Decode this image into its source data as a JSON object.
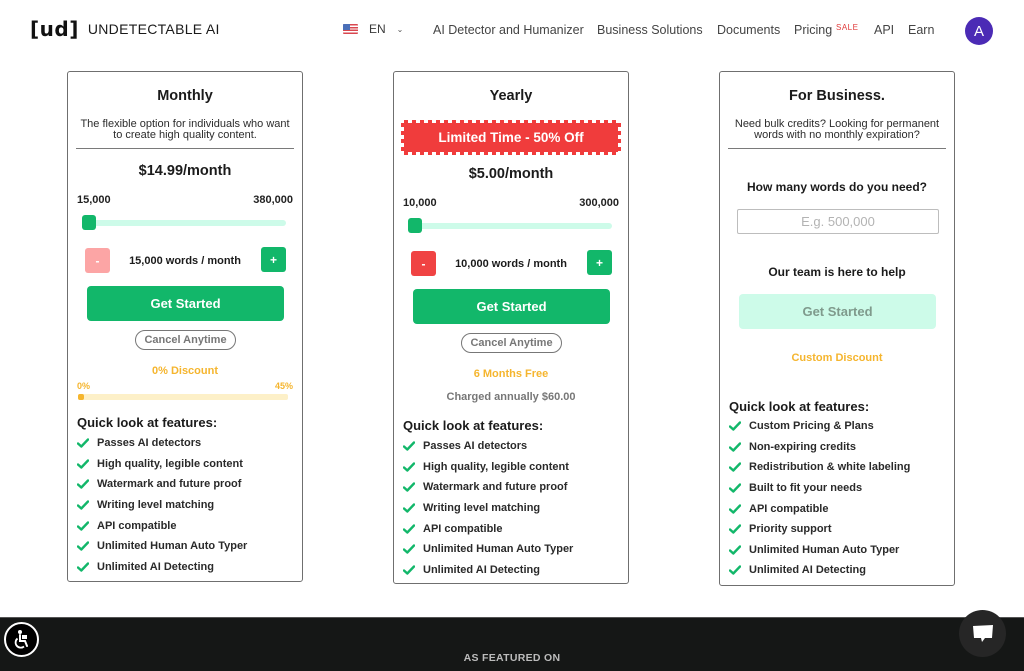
{
  "header": {
    "logo_mark": "[ud]",
    "logo_text": "UNDETECTABLE AI",
    "language": "EN",
    "nav": [
      {
        "label": "AI Detector and Humanizer"
      },
      {
        "label": "Business Solutions"
      },
      {
        "label": "Documents"
      },
      {
        "label": "Pricing"
      },
      {
        "label": "API"
      },
      {
        "label": "Earn"
      }
    ],
    "sale_badge": "SALE",
    "avatar_initial": "A"
  },
  "colors": {
    "accent_green": "#12b76a",
    "light_green": "#cdfbe9",
    "sale_red": "#f03c3c",
    "discount_orange": "#f5b52e",
    "avatar_purple": "#4b2bb5"
  },
  "plans": {
    "monthly": {
      "title": "Monthly",
      "description": "The flexible option for individuals who want to create high quality content.",
      "price": "$14.99/month",
      "range_min": "15,000",
      "range_max": "380,000",
      "slider_value_fraction": 0,
      "minus_label": "-",
      "plus_label": "+",
      "words": "15,000 words / month",
      "cta": "Get Started",
      "cancel": "Cancel Anytime",
      "discount_text": "0% Discount",
      "discount_min": "0%",
      "discount_max": "45%",
      "discount_percent": 0,
      "features_title": "Quick look at features:",
      "features": [
        "Passes AI detectors",
        "High quality, legible content",
        "Watermark and future proof",
        "Writing level matching",
        "API compatible",
        "Unlimited Human Auto Typer",
        "Unlimited AI Detecting"
      ]
    },
    "yearly": {
      "title": "Yearly",
      "banner": "Limited Time - 50% Off",
      "price": "$5.00/month",
      "range_min": "10,000",
      "range_max": "300,000",
      "slider_value_fraction": 0,
      "minus_label": "-",
      "plus_label": "+",
      "words": "10,000 words / month",
      "cta": "Get Started",
      "cancel": "Cancel Anytime",
      "bonus": "6 Months Free",
      "charged": "Charged annually $60.00",
      "features_title": "Quick look at features:",
      "features": [
        "Passes AI detectors",
        "High quality, legible content",
        "Watermark and future proof",
        "Writing level matching",
        "API compatible",
        "Unlimited Human Auto Typer",
        "Unlimited AI Detecting"
      ]
    },
    "business": {
      "title": "For Business.",
      "description": "Need bulk credits? Looking for permanent words with no monthly expiration?",
      "question": "How many words do you need?",
      "input_placeholder": "E.g. 500,000",
      "input_value": "",
      "help_text": "Our team is here to help",
      "cta": "Get Started",
      "discount_text": "Custom Discount",
      "features_title": "Quick look at features:",
      "features": [
        "Custom Pricing & Plans",
        "Non-expiring credits",
        "Redistribution & white labeling",
        "Built to fit your needs",
        "API compatible",
        "Priority support",
        "Unlimited Human Auto Typer",
        "Unlimited AI Detecting"
      ]
    }
  },
  "footer": {
    "featured_label": "AS FEATURED ON"
  }
}
